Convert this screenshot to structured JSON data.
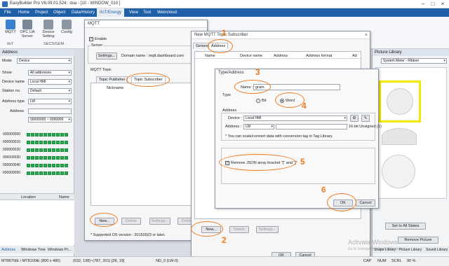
{
  "titlebar": {
    "title": "EasyBuilder Pro V6.09.01.524 : dua - [10 - WINDOW_010 ]"
  },
  "menu": [
    "File",
    "Home",
    "Project",
    "Object",
    "Data/History",
    "IIoT/Energy",
    "View",
    "Tool",
    "Weincloud"
  ],
  "ribbon": {
    "buttons": [
      "MQTT",
      "OPC UA Server",
      "Device Setting",
      "Config"
    ],
    "groups": [
      "IIoT",
      "SECS/GEM"
    ]
  },
  "address_panel": {
    "header": "Address",
    "mode_label": "Mode",
    "mode_value": "Device",
    "show_label": "Show",
    "show_value": "All addresses",
    "device_name_label": "Device name",
    "device_name_value": "Local HMI",
    "station_label": "Station no.",
    "station_value": "Default",
    "addr_type_label": "Address type",
    "addr_type_value": "LW",
    "address_label": "Address",
    "address_range": "00000000 ~ 0099999",
    "rows": [
      "000000000",
      "000000010",
      "000000020",
      "000000030",
      "000000040",
      "000000050"
    ],
    "location_header": "Location",
    "name_header": "Name",
    "tabs": [
      "Address",
      "Windows Tree",
      "Windows Pr..."
    ]
  },
  "mqtt_dialog": {
    "title": "MQTT",
    "enable_label": "Enable",
    "server_label": "Server",
    "settings_btn": "Settings...",
    "domain_text": "Domain name : mqtt.dashboard.com",
    "topic_label": "MQTT Topic",
    "tabs": [
      "Topic Publisher",
      "Topic Subscriber"
    ],
    "col_nickname": "Nickname",
    "buttons": [
      "New...",
      "Delete",
      "Settings...",
      "Delete"
    ],
    "footnote": "* Supported OS version : 20150923 or later."
  },
  "subscriber_dialog": {
    "title": "New MQTT Topic Subscriber",
    "tabs": [
      "General",
      "Address"
    ],
    "columns": [
      "Name",
      "Device name",
      "Address",
      "Address format",
      "Ad"
    ],
    "buttons": [
      "New...",
      "Delete",
      "Settings..."
    ],
    "ok": "OK",
    "cancel": "Cancel"
  },
  "type_address_dialog": {
    "title": "Type/Address",
    "name_label": "Name :",
    "name_value": "gram",
    "type_label": "Type",
    "bit_label": "Bit",
    "word_label": "Word",
    "address_label": "Address",
    "device_label": "Device :",
    "device_value": "Local HMI",
    "addr_label": "Address :",
    "addr_type": "LW",
    "addr_format": "16-bit Unsigned (1)",
    "note": "* You can scale/convert data with conversion tag in Tag Library.",
    "remove_json": "Remove JSON array bracket \"[\" and \"]\"",
    "ok": "OK",
    "cancel": "Cancel"
  },
  "right_panel": {
    "header": "Picture Library",
    "selector": "System Meter - Ribbon",
    "set_all_states": "Set to All States",
    "remove_picture": "Remove Picture",
    "tabs": [
      "Shape Library",
      "Picture Library",
      "Sound Library"
    ]
  },
  "watermark": {
    "line1": "Activate Windows",
    "line2": "Go to Settings to activate Windows."
  },
  "statusbar": {
    "model": "MT8070iE / MT8100iE (800 x 480)",
    "coords": "(632, 138)~(787, 201) [28, 19]",
    "nd": "ND_0 (LW-0)",
    "caps": "CAP",
    "num": "NUM",
    "scrl": "SCRL",
    "zoom": "90 %"
  },
  "annotations": [
    "1",
    "2",
    "3",
    "4",
    "5",
    "6"
  ],
  "colors": {
    "menu_bg": "#1e5fa8",
    "annotation": "#f07a1e"
  }
}
